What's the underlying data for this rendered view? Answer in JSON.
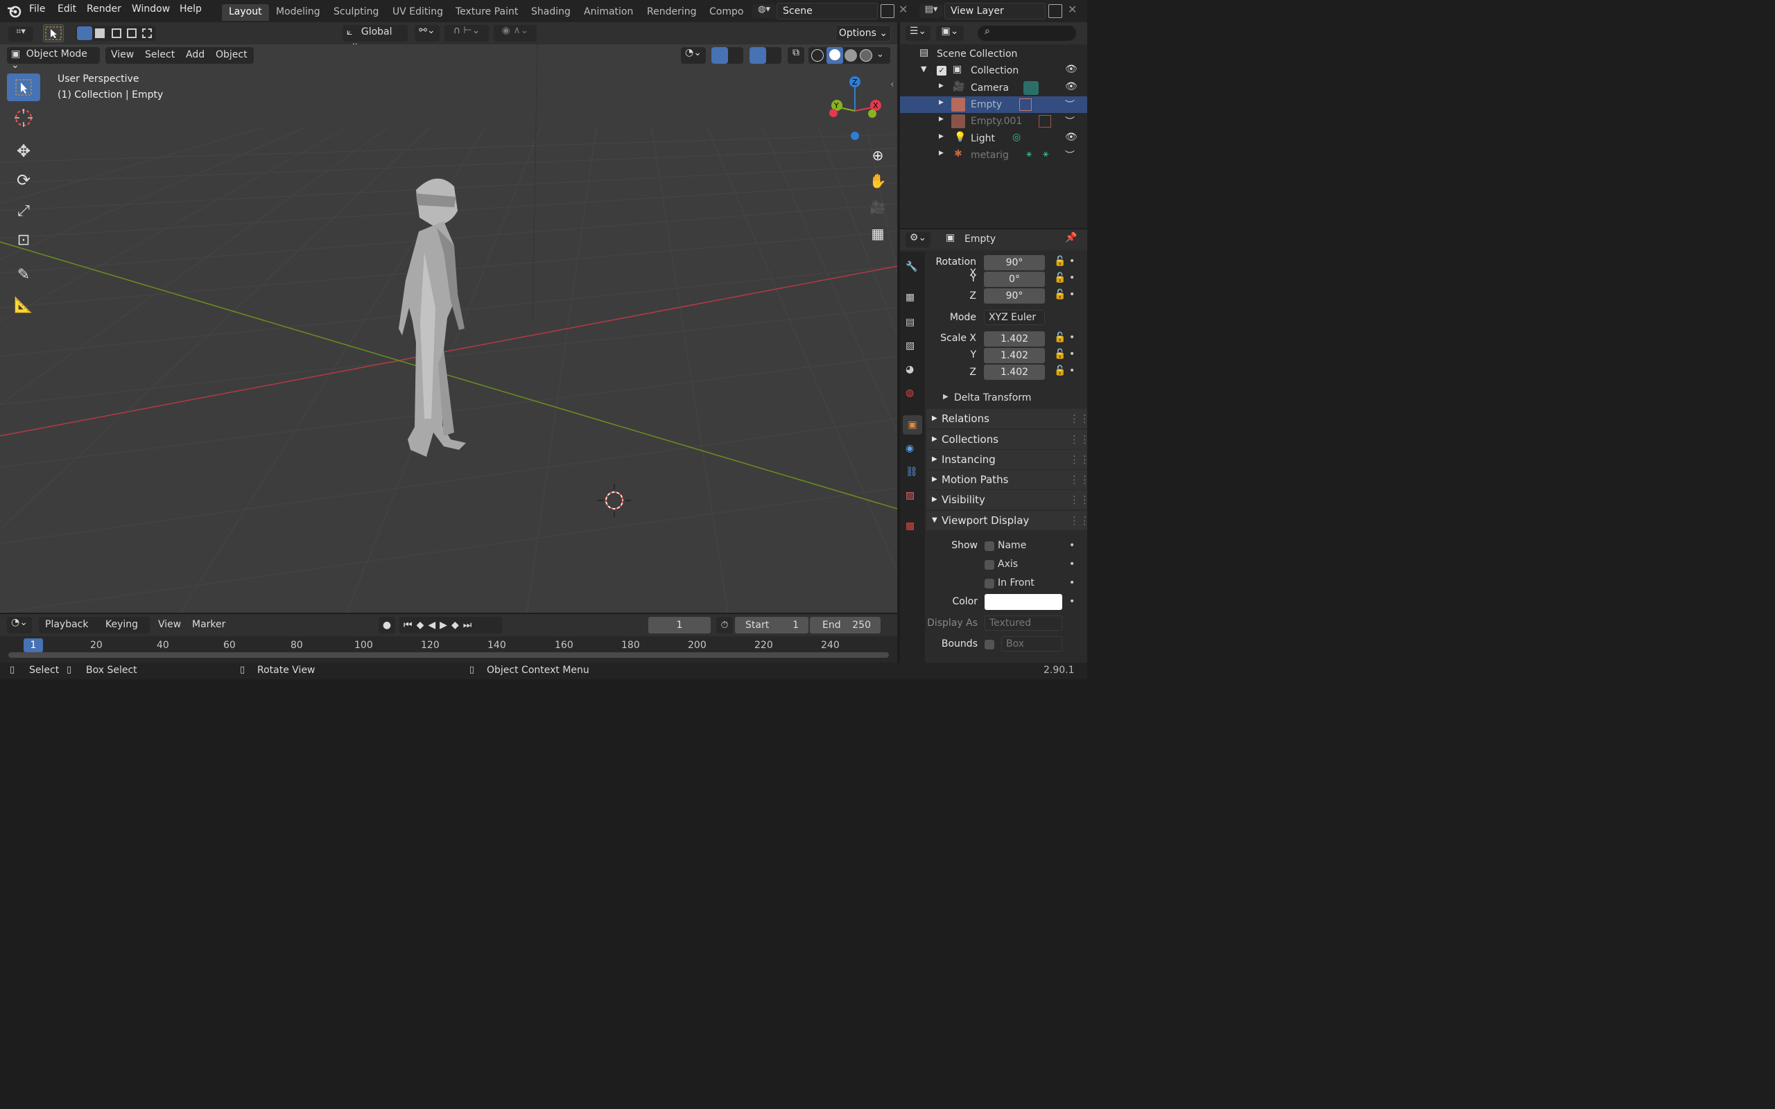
{
  "topbar": {
    "menus": [
      "File",
      "Edit",
      "Render",
      "Window",
      "Help"
    ],
    "workspaces": [
      "Layout",
      "Modeling",
      "Sculpting",
      "UV Editing",
      "Texture Paint",
      "Shading",
      "Animation",
      "Rendering",
      "Compo"
    ],
    "active_workspace": "Layout",
    "scene": "Scene",
    "view_layer": "View Layer"
  },
  "tool_header": {
    "orientation": "Global",
    "options_label": "Options"
  },
  "viewport_header": {
    "mode": "Object Mode",
    "menus": [
      "View",
      "Select",
      "Add",
      "Object"
    ]
  },
  "viewport": {
    "perspective": "User Perspective",
    "context": "(1) Collection | Empty",
    "gizmo": {
      "x": "X",
      "y": "Y",
      "z": "Z"
    }
  },
  "outliner": {
    "root": "Scene Collection",
    "items": [
      {
        "label": "Collection",
        "icon": "collection-icon"
      },
      {
        "label": "Camera",
        "icon": "camera-object-icon"
      },
      {
        "label": "Empty",
        "icon": "image-empty-icon"
      },
      {
        "label": "Empty.001",
        "icon": "image-empty-icon"
      },
      {
        "label": "Light",
        "icon": "light-object-icon"
      },
      {
        "label": "metarig",
        "icon": "armature-icon"
      }
    ]
  },
  "properties": {
    "object_name": "Empty",
    "rotation_label": "Rotation X",
    "rotation": {
      "x": "90°",
      "y": "0°",
      "z": "90°"
    },
    "axis_y": "Y",
    "axis_z": "Z",
    "mode_label": "Mode",
    "mode_value": "XYZ Euler",
    "scale_label": "Scale X",
    "scale": {
      "x": "1.402",
      "y": "1.402",
      "z": "1.402"
    },
    "delta_transform": "Delta Transform",
    "panels": [
      "Relations",
      "Collections",
      "Instancing",
      "Motion Paths",
      "Visibility"
    ],
    "viewport_display": "Viewport Display",
    "show_label": "Show",
    "show_options": [
      "Name",
      "Axis",
      "In Front"
    ],
    "color_label": "Color",
    "display_as_label": "Display As",
    "display_as_value": "Textured",
    "bounds_label": "Bounds",
    "bounds_value": "Box"
  },
  "timeline": {
    "menus": [
      "Playback",
      "Keying",
      "View",
      "Marker"
    ],
    "current_frame": "1",
    "start_label": "Start",
    "start_value": "1",
    "end_label": "End",
    "end_value": "250",
    "ticks": [
      "1",
      "20",
      "40",
      "60",
      "80",
      "100",
      "120",
      "140",
      "160",
      "180",
      "200",
      "220",
      "240"
    ]
  },
  "statusbar": {
    "select": "Select",
    "box_select": "Box Select",
    "rotate_view": "Rotate View",
    "context_menu": "Object Context Menu",
    "version": "2.90.1"
  },
  "colors": {
    "accent": "#4772b3",
    "x_axis": "#e6394f",
    "y_axis": "#8ab41f",
    "z_axis": "#2e7ed8"
  }
}
